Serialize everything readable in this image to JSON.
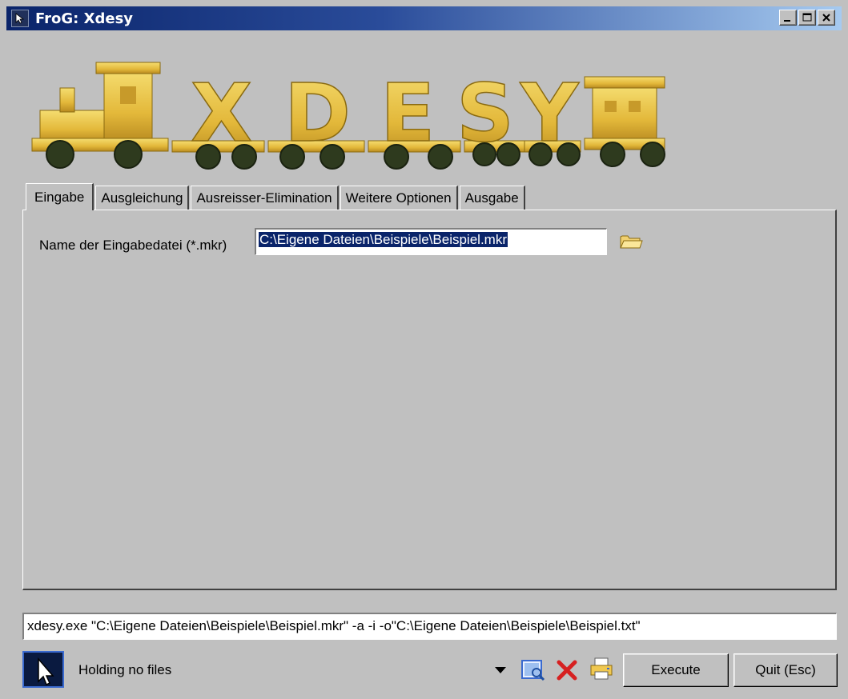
{
  "window": {
    "title": "FroG: Xdesy"
  },
  "banner": {
    "letters": [
      "X",
      "D",
      "E",
      "S",
      "Y"
    ]
  },
  "tabs": [
    {
      "label": "Eingabe",
      "active": true
    },
    {
      "label": "Ausgleichung",
      "active": false
    },
    {
      "label": "Ausreisser-Elimination",
      "active": false
    },
    {
      "label": "Weitere Optionen",
      "active": false
    },
    {
      "label": "Ausgabe",
      "active": false
    }
  ],
  "input_panel": {
    "label": "Name der Eingabedatei (*.mkr)",
    "value": "C:\\Eigene Dateien\\Beispiele\\Beispiel.mkr"
  },
  "command_line": "xdesy.exe \"C:\\Eigene Dateien\\Beispiele\\Beispiel.mkr\" -a -i -o\"C:\\Eigene Dateien\\Beispiele\\Beispiel.txt\"",
  "status": {
    "holding": "Holding no files"
  },
  "buttons": {
    "execute": "Execute",
    "quit": "Quit (Esc)"
  },
  "icons": [
    "app-icon",
    "minimize-icon",
    "maximize-icon",
    "close-icon",
    "folder-icon",
    "cursor-icon",
    "dropdown-arrow-icon",
    "preview-icon",
    "delete-icon",
    "print-icon"
  ]
}
